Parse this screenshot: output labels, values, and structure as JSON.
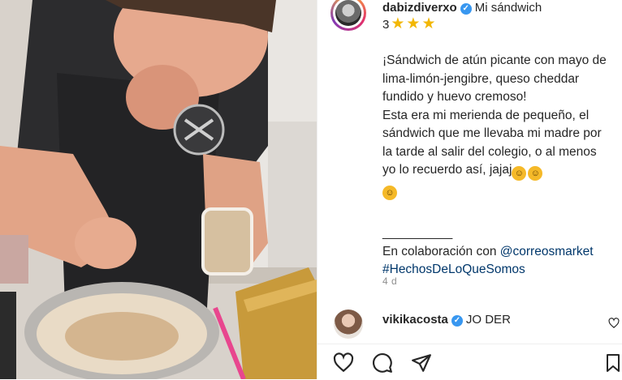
{
  "post": {
    "username": "dabizdiverxo",
    "title": "Mi sándwich",
    "rating_number": "3",
    "rating_stars": 3,
    "caption": {
      "p1": "¡Sándwich de atún picante con mayo de lima-limón-jengibre, queso cheddar fundido y huevo cremoso!",
      "p2": "Esta era mi merienda de pequeño, el sándwich que me llevaba mi madre por la tarde al salir del colegio, o al menos yo lo recuerdo así, jajaj",
      "divider": "__________",
      "collab_prefix": "En colaboración con",
      "collab_mention": "@correosmarket",
      "hashtag": "#HechosDeLoQueSomos"
    },
    "age": "4 d"
  },
  "comment": {
    "username": "vikikacosta",
    "text": "JO DER"
  },
  "icons": {
    "verified": "verified-badge-icon",
    "star": "star-icon",
    "emoji": "rolling-laughing-emoji-icon",
    "like": "heart-icon",
    "comment": "comment-icon",
    "share": "send-icon",
    "save": "bookmark-icon"
  },
  "colors": {
    "verified": "#3897f0",
    "link": "#00376b",
    "star": "#f2b705",
    "muted": "#8e8e8e"
  }
}
